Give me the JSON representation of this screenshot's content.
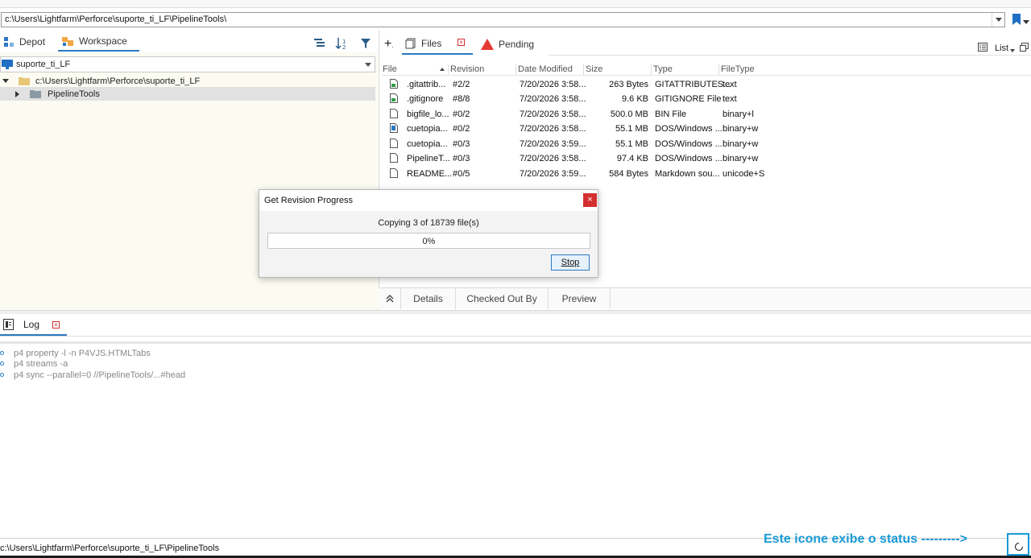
{
  "address_bar": {
    "path": "c:\\Users\\Lightfarm\\Perforce\\suporte_ti_LF\\PipelineTools\\"
  },
  "left_pane": {
    "tabs": [
      {
        "label": "Depot"
      },
      {
        "label": "Workspace"
      }
    ],
    "workspace_name": "suporte_ti_LF",
    "tree": [
      {
        "label": "c:\\Users\\Lightfarm\\Perforce\\suporte_ti_LF"
      },
      {
        "label": "PipelineTools"
      }
    ]
  },
  "right_pane": {
    "tabs": [
      {
        "label": "Files"
      },
      {
        "label": "Pending"
      }
    ],
    "view_mode": "List",
    "columns": [
      "File",
      "Revision",
      "Date Modified",
      "Size",
      "Type",
      "FileType"
    ],
    "files": [
      {
        "file": ".gitattrib...",
        "revision": "#2/2",
        "date": "7/20/2026 3:58...",
        "size": "263 Bytes",
        "type": "GITATTRIBUTES...",
        "filetype": "text",
        "icon": "synced-file-icon"
      },
      {
        "file": ".gitignore",
        "revision": "#8/8",
        "date": "7/20/2026 3:58...",
        "size": "9.6 KB",
        "type": "GITIGNORE File",
        "filetype": "text",
        "icon": "synced-file-icon"
      },
      {
        "file": "bigfile_lo...",
        "revision": "#0/2",
        "date": "7/20/2026 3:58...",
        "size": "500.0 MB",
        "type": "BIN File",
        "filetype": "binary+l",
        "icon": "file-icon"
      },
      {
        "file": "cuetopia...",
        "revision": "#0/2",
        "date": "7/20/2026 3:58...",
        "size": "55.1 MB",
        "type": "DOS/Windows ...",
        "filetype": "binary+w",
        "icon": "exe-file-icon"
      },
      {
        "file": "cuetopia...",
        "revision": "#0/3",
        "date": "7/20/2026 3:59...",
        "size": "55.1 MB",
        "type": "DOS/Windows ...",
        "filetype": "binary+w",
        "icon": "file-icon"
      },
      {
        "file": "PipelineT...",
        "revision": "#0/3",
        "date": "7/20/2026 3:58...",
        "size": "97.4 KB",
        "type": "DOS/Windows ...",
        "filetype": "binary+w",
        "icon": "file-icon"
      },
      {
        "file": "README...",
        "revision": "#0/5",
        "date": "7/20/2026 3:59...",
        "size": "584 Bytes",
        "type": "Markdown sou...",
        "filetype": "unicode+S",
        "icon": "file-icon"
      }
    ],
    "bottom_tabs": [
      {
        "label": "Details"
      },
      {
        "label": "Checked Out By"
      },
      {
        "label": "Preview"
      }
    ]
  },
  "dialog": {
    "title": "Get Revision Progress",
    "close_label": "×",
    "message": "Copying 3 of 18739 file(s)",
    "progress_percent": 0,
    "progress_text": "0%",
    "stop_label": "Stop"
  },
  "log": {
    "tab_label": "Log",
    "entries": [
      "p4 property -l -n P4VJS.HTMLTabs",
      "p4 streams -a",
      "p4 sync --parallel=0 //PipelineTools/...#head"
    ]
  },
  "status_bar": {
    "path": "c:\\Users\\Lightfarm\\Perforce\\suporte_ti_LF\\PipelineTools"
  },
  "annotation": {
    "text": "Este icone exibe o status --------->"
  },
  "colors": {
    "accent": "#2a79c0",
    "annotation": "#1a9ad6",
    "close_red": "#d32f2f",
    "pending_red": "#e53935"
  }
}
